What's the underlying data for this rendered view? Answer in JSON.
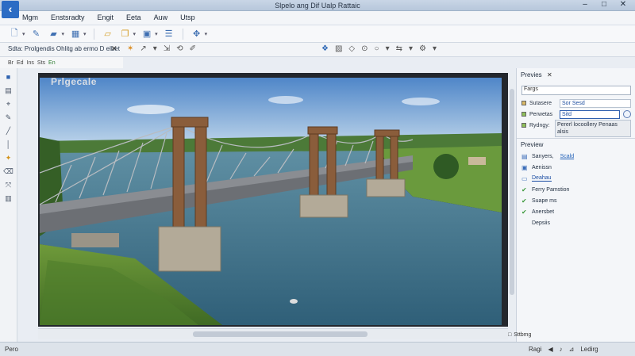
{
  "window": {
    "title": "Slpelo ang Dif Ualp Rattaic",
    "controls": {
      "minimize": "–",
      "maximize": "□",
      "close": "✕"
    }
  },
  "menu": [
    "Mgm",
    "Enstsradty",
    "Engit",
    "Eeta",
    "Auw",
    "Utsp"
  ],
  "toolbar": {
    "icons": [
      "new-file-icon",
      "open-icon",
      "folder-icon",
      "grid-icon",
      "folder-open-icon",
      "copy-icon",
      "save-icon",
      "list-icon",
      "move-icon"
    ]
  },
  "toolbar2": {
    "panel_title": "Sdta: Prolgendis Ohlitg ab ermo D elbet",
    "close": "✕"
  },
  "layer_tabs": [
    "Br",
    "Ed",
    "Ins",
    "Sts",
    "En"
  ],
  "viewport": {
    "label": "Prlgecale"
  },
  "right_panel": {
    "preview_header": "Previes",
    "close": "✕",
    "search_value": "Fargs",
    "rows": [
      {
        "label": "Sutasere",
        "value": "Sor Sesd"
      },
      {
        "label": "Perwetas",
        "value": "Sitd"
      },
      {
        "label": "Rydngy:",
        "value": ""
      }
    ],
    "description": "Pererl locoollery Penaas alsis",
    "tree_header": "Preview",
    "tree": [
      {
        "label": "Sanyers,",
        "link": "Scald",
        "icon": "layers-icon"
      },
      {
        "label": "Aenissn",
        "icon": "image-icon"
      },
      {
        "label": "Deahau",
        "icon": "doc-icon",
        "selected": true
      },
      {
        "label": "Ferry Pamstion",
        "icon": "check-icon"
      },
      {
        "label": "Suape ms",
        "icon": "check-icon"
      },
      {
        "label": "Anersbet",
        "icon": "check-icon"
      },
      {
        "label": "Depsiis",
        "icon": "none"
      }
    ]
  },
  "status": {
    "left": "Pero",
    "middle": "Sttbmg",
    "right_items": [
      "Ragi",
      "Ledirg"
    ]
  }
}
